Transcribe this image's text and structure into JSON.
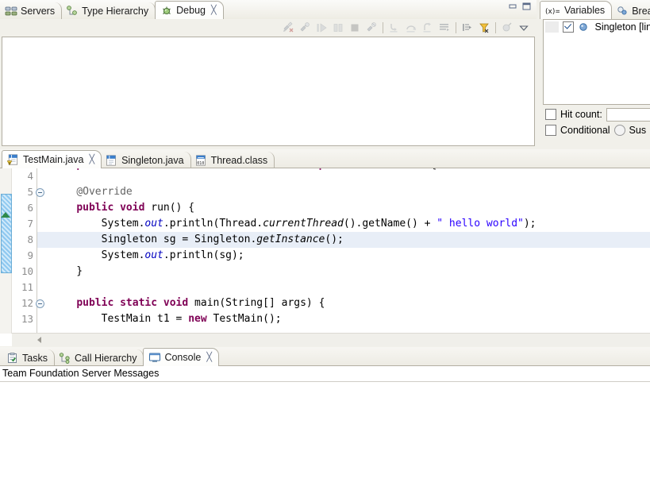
{
  "window": {
    "minimize_label": "Minimize",
    "maximize_label": "Maximize"
  },
  "debug_view": {
    "tabs": [
      {
        "label": "Servers",
        "icon": "servers-icon",
        "active": false,
        "closable": false
      },
      {
        "label": "Type Hierarchy",
        "icon": "type-hierarchy-icon",
        "active": false,
        "closable": false
      },
      {
        "label": "Debug",
        "icon": "debug-icon",
        "active": true,
        "closable": true
      }
    ],
    "close_glyph": "╳",
    "toolbar": [
      {
        "name": "remove-all-terminated-button",
        "enabled": false
      },
      {
        "name": "connect-button",
        "enabled": false
      },
      {
        "name": "resume-button",
        "enabled": false
      },
      {
        "name": "suspend-button",
        "enabled": false
      },
      {
        "name": "terminate-button",
        "enabled": false
      },
      {
        "name": "disconnect-button",
        "enabled": false
      },
      {
        "name": "step-into-button",
        "enabled": false
      },
      {
        "name": "step-over-button",
        "enabled": false
      },
      {
        "name": "step-return-button",
        "enabled": false
      },
      {
        "name": "drop-to-frame-button",
        "enabled": false
      },
      {
        "name": "step-with-filters-button",
        "enabled": false
      },
      {
        "name": "use-step-filters-button",
        "enabled": true
      },
      {
        "name": "instruction-stepping-button",
        "enabled": false
      },
      {
        "name": "view-menu-button",
        "enabled": true
      }
    ],
    "body_text": ""
  },
  "variables_view": {
    "tabs": [
      {
        "label": "Variables",
        "icon": "variables-icon",
        "active": true,
        "closable": false
      },
      {
        "label": "Break",
        "icon": "breakpoints-icon",
        "active": false,
        "closable": false
      }
    ],
    "breakpoints": [
      {
        "label": "Singleton [lin",
        "checked": true,
        "icon": "breakpoint-icon"
      }
    ],
    "details": {
      "hit_count_label": "Hit count:",
      "hit_count_value": "",
      "conditional_label": "Conditional",
      "suspend_label": "Sus"
    }
  },
  "editor": {
    "tabs": [
      {
        "label": "TestMain.java",
        "icon": "java-warning-icon",
        "active": true,
        "closable": true
      },
      {
        "label": "Singleton.java",
        "icon": "java-icon",
        "active": false,
        "closable": false
      },
      {
        "label": "Thread.class",
        "icon": "class-icon",
        "active": false,
        "closable": false
      }
    ],
    "close_glyph": "╳",
    "first_visible_line": 4,
    "highlighted_line": 8,
    "current_instruction_line": 6,
    "gutter_lines": [
      {
        "number": "4",
        "fold": false
      },
      {
        "number": "5",
        "fold": true
      },
      {
        "number": "6",
        "fold": false
      },
      {
        "number": "7",
        "fold": false
      },
      {
        "number": "8",
        "fold": false
      },
      {
        "number": "9",
        "fold": false
      },
      {
        "number": "10",
        "fold": false
      },
      {
        "number": "11",
        "fold": false
      },
      {
        "number": "12",
        "fold": true
      },
      {
        "number": "13",
        "fold": false
      }
    ],
    "code_lines": [
      {
        "n": 4,
        "segments": []
      },
      {
        "n": 5,
        "segments": [
          {
            "t": "    ",
            "c": "pln"
          },
          {
            "t": "@Override",
            "c": "an"
          }
        ]
      },
      {
        "n": 6,
        "segments": [
          {
            "t": "    ",
            "c": "pln"
          },
          {
            "t": "public",
            "c": "kw"
          },
          {
            "t": " ",
            "c": "pln"
          },
          {
            "t": "void",
            "c": "kw"
          },
          {
            "t": " run() {",
            "c": "pln"
          }
        ]
      },
      {
        "n": 7,
        "segments": [
          {
            "t": "        System.",
            "c": "pln"
          },
          {
            "t": "out",
            "c": "fld"
          },
          {
            "t": ".println(Thread.",
            "c": "pln"
          },
          {
            "t": "currentThread",
            "c": "mth"
          },
          {
            "t": "().getName() + ",
            "c": "pln"
          },
          {
            "t": "\" hello world\"",
            "c": "st"
          },
          {
            "t": ");",
            "c": "pln"
          }
        ]
      },
      {
        "n": 8,
        "segments": [
          {
            "t": "        Singleton sg = Singleton.",
            "c": "pln"
          },
          {
            "t": "getInstance",
            "c": "mth"
          },
          {
            "t": "();",
            "c": "pln"
          }
        ]
      },
      {
        "n": 9,
        "segments": [
          {
            "t": "        System.",
            "c": "pln"
          },
          {
            "t": "out",
            "c": "fld"
          },
          {
            "t": ".println(sg);",
            "c": "pln"
          }
        ]
      },
      {
        "n": 10,
        "segments": [
          {
            "t": "    }",
            "c": "pln"
          }
        ]
      },
      {
        "n": 11,
        "segments": []
      },
      {
        "n": 12,
        "segments": [
          {
            "t": "    ",
            "c": "pln"
          },
          {
            "t": "public",
            "c": "kw"
          },
          {
            "t": " ",
            "c": "pln"
          },
          {
            "t": "static",
            "c": "kw"
          },
          {
            "t": " ",
            "c": "pln"
          },
          {
            "t": "void",
            "c": "kw"
          },
          {
            "t": " main(String[] args) {",
            "c": "pln"
          }
        ]
      },
      {
        "n": 13,
        "segments": [
          {
            "t": "        TestMain t1 = ",
            "c": "pln"
          },
          {
            "t": "new",
            "c": "kw"
          },
          {
            "t": " TestMain();",
            "c": "pln"
          }
        ]
      }
    ],
    "partial_top_line": {
      "segments": [
        {
          "t": "    ",
          "c": "pln"
        },
        {
          "t": "public",
          "c": "kw"
        },
        {
          "t": " ",
          "c": "pln"
        },
        {
          "t": "class",
          "c": "kw"
        },
        {
          "t": " TestMain ",
          "c": "pln"
        },
        {
          "t": "extends",
          "c": "kw"
        },
        {
          "t": " Thread ",
          "c": "pln"
        },
        {
          "t": "implements",
          "c": "kw"
        },
        {
          "t": " Runnable {",
          "c": "pln"
        }
      ]
    }
  },
  "bottom_view": {
    "tabs": [
      {
        "label": "Tasks",
        "icon": "tasks-icon",
        "active": false,
        "closable": false
      },
      {
        "label": "Call Hierarchy",
        "icon": "call-hierarchy-icon",
        "active": false,
        "closable": false
      },
      {
        "label": "Console",
        "icon": "console-icon",
        "active": true,
        "closable": true
      }
    ],
    "close_glyph": "╳",
    "console_title": "Team Foundation Server Messages",
    "console_content": ""
  },
  "colors": {
    "keyword": "#7f0055",
    "string": "#2a00ff",
    "field": "#0000c0",
    "annotation": "#646464",
    "highlight_line": "#e8eef7",
    "chrome": "#f1f0ea",
    "border": "#b2aea2"
  }
}
